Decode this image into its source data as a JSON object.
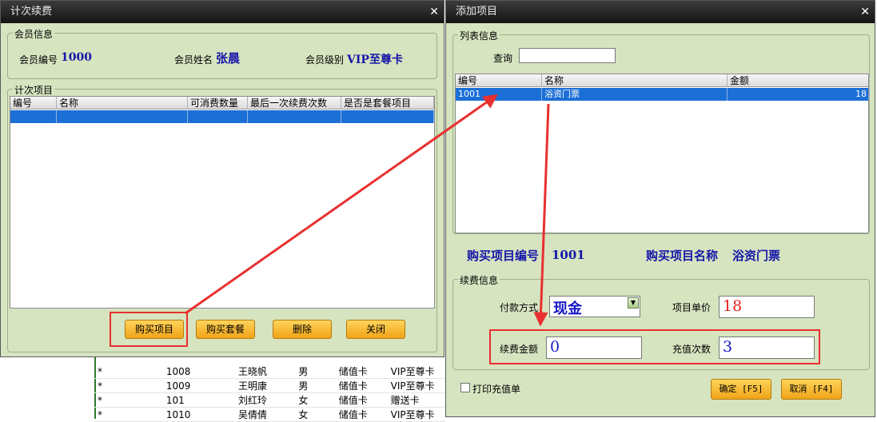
{
  "bg_rows": [
    {
      "mark": "*",
      "id": "1008",
      "name": "王晓帆",
      "sex": "男",
      "card": "储值卡",
      "level": "VIP至尊卡"
    },
    {
      "mark": "*",
      "id": "1009",
      "name": "王明康",
      "sex": "男",
      "card": "储值卡",
      "level": "VIP至尊卡"
    },
    {
      "mark": "*",
      "id": "101",
      "name": "刘红玲",
      "sex": "女",
      "card": "储值卡",
      "level": "赠送卡"
    },
    {
      "mark": "*",
      "id": "1010",
      "name": "吴倩倩",
      "sex": "女",
      "card": "储值卡",
      "level": "VIP至尊卡"
    }
  ],
  "left": {
    "title": "计次续费",
    "member_group": "会员信息",
    "member_no_label": "会员编号",
    "member_no": "1000",
    "member_name_label": "会员姓名",
    "member_name": "张晨",
    "member_level_label": "会员级别",
    "member_level": "VIP至尊卡",
    "items_group": "计次项目",
    "columns": [
      "编号",
      "名称",
      "可消费数量",
      "最后一次续费次数",
      "是否是套餐项目"
    ],
    "buttons": {
      "buy_item": "购买项目",
      "buy_package": "购买套餐",
      "delete": "删除",
      "close": "关闭"
    }
  },
  "right": {
    "title": "添加项目",
    "list_group": "列表信息",
    "search_label": "查询",
    "search_value": "",
    "columns": [
      "编号",
      "名称",
      "金额"
    ],
    "rows": [
      {
        "id": "1001",
        "name": "浴资门票",
        "amount": "18"
      }
    ],
    "buy_no_label": "购买项目编号",
    "buy_no": "1001",
    "buy_name_label": "购买项目名称",
    "buy_name": "浴资门票",
    "renew_group": "续费信息",
    "pay_label": "付款方式",
    "pay_value": "现金",
    "unit_price_label": "项目单价",
    "unit_price": "18",
    "renew_amount_label": "续费金额",
    "renew_amount": "0",
    "recharge_count_label": "充值次数",
    "recharge_count": "3",
    "print_label": "打印充值单",
    "ok_label": "确定 [F5]",
    "cancel_label": "取消 [F4]"
  },
  "colors": {
    "title_bg": "#1a1a1a",
    "panel_bg": "#d6e4c0",
    "selected_row": "#1c6fd6",
    "highlight": "#e83030",
    "button": "#f0a418"
  }
}
